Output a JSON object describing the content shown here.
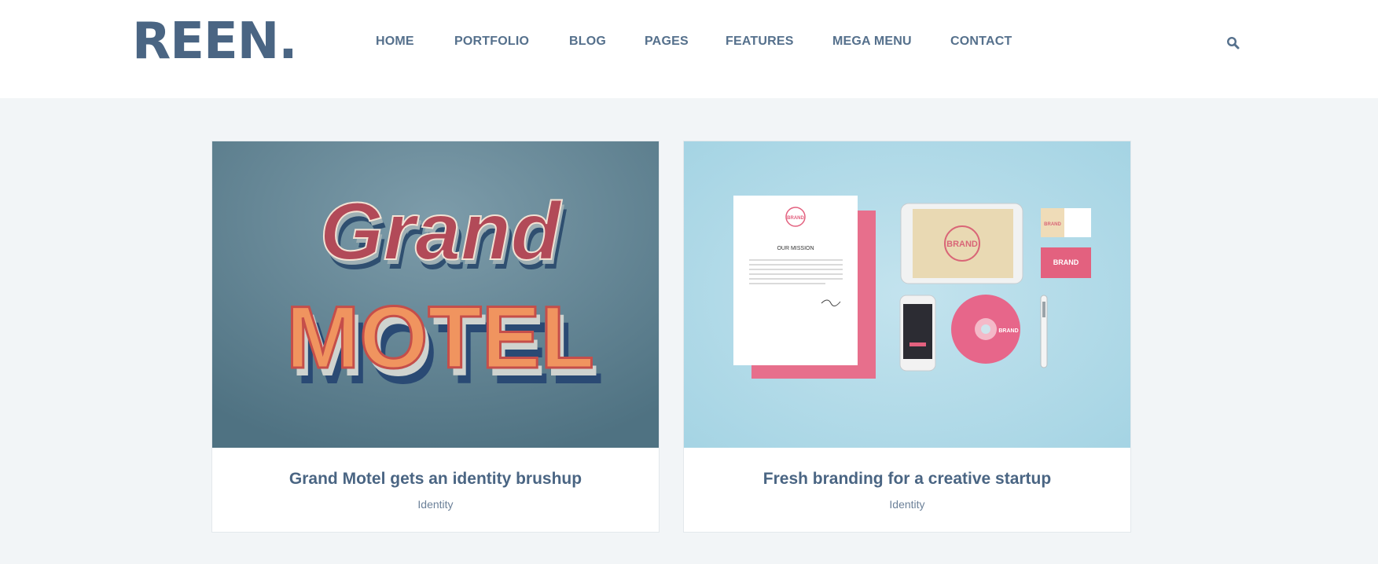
{
  "header": {
    "logo": "REEN.",
    "nav": [
      "HOME",
      "PORTFOLIO",
      "BLOG",
      "PAGES",
      "FEATURES",
      "MEGA MENU",
      "CONTACT"
    ]
  },
  "colors": {
    "brand": "#4a6583",
    "nav": "#55708c",
    "background": "#f2f5f7"
  },
  "icons": {
    "search": "search-icon"
  },
  "cards": [
    {
      "title": "Grand Motel gets an identity brushup",
      "category": "Identity",
      "image_text_top": "Grand",
      "image_text_bottom": "MOTEL"
    },
    {
      "title": "Fresh branding for a creative startup",
      "category": "Identity",
      "mock": {
        "brand": "BRAND",
        "mission": "OUR MISSION"
      }
    }
  ]
}
